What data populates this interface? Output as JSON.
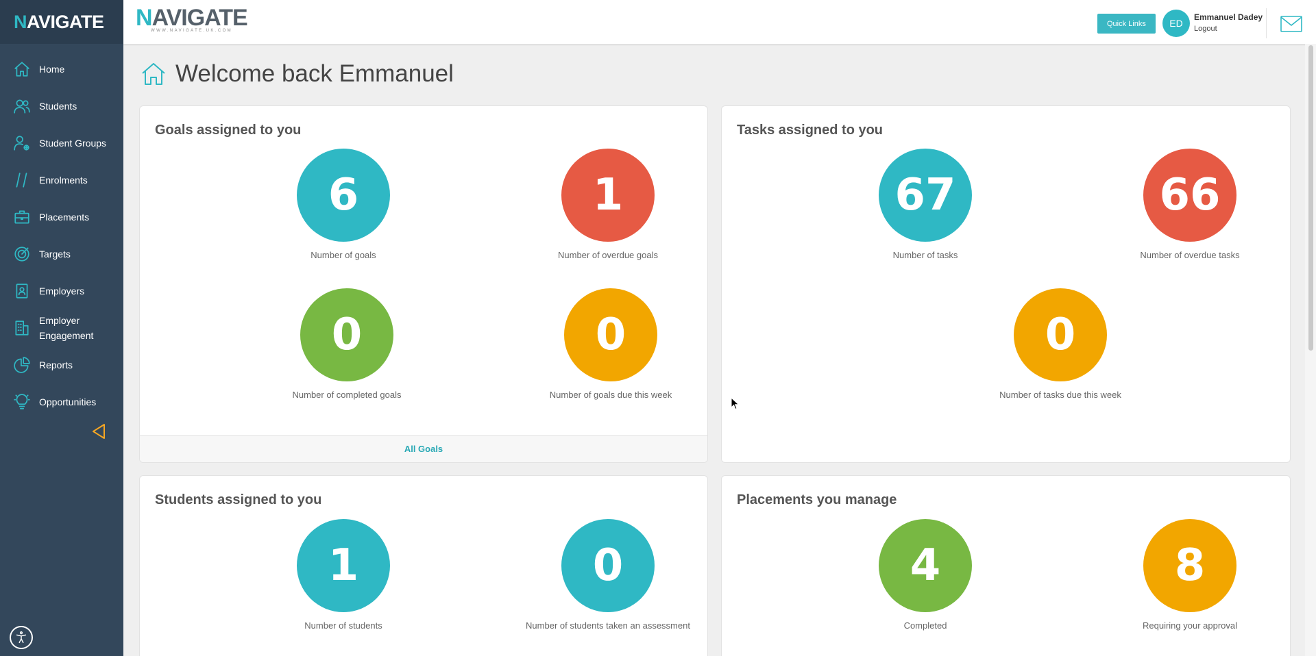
{
  "app": {
    "logo_text_n": "N",
    "logo_text_rest": "AVIGATE",
    "logo_tagline": "WWW.NAVIGATE.UK.COM"
  },
  "sidebar": {
    "items": [
      {
        "label": "Home",
        "icon": "home-icon"
      },
      {
        "label": "Students",
        "icon": "users-icon"
      },
      {
        "label": "Student Groups",
        "icon": "user-group-icon"
      },
      {
        "label": "Enrolments",
        "icon": "slashes-icon"
      },
      {
        "label": "Placements",
        "icon": "briefcase-icon"
      },
      {
        "label": "Targets",
        "icon": "target-icon"
      },
      {
        "label": "Employers",
        "icon": "id-badge-icon"
      },
      {
        "label": "Employer Engagement",
        "icon": "building-icon"
      },
      {
        "label": "Reports",
        "icon": "pie-chart-icon"
      },
      {
        "label": "Opportunities",
        "icon": "lightbulb-icon"
      }
    ]
  },
  "header": {
    "quick_links": "Quick Links",
    "user_initials": "ED",
    "user_name": "Emmanuel Dadey",
    "logout": "Logout"
  },
  "main": {
    "title": "Welcome back Emmanuel",
    "goals": {
      "title": "Goals assigned to you",
      "stats": [
        {
          "value": "6",
          "label": "Number of goals",
          "color": "#2fb8c4"
        },
        {
          "value": "1",
          "label": "Number of overdue goals",
          "color": "#e65a44"
        },
        {
          "value": "0",
          "label": "Number of completed goals",
          "color": "#78b843"
        },
        {
          "value": "0",
          "label": "Number of goals due this week",
          "color": "#f2a600"
        }
      ],
      "footer": "All Goals"
    },
    "tasks": {
      "title": "Tasks assigned to you",
      "stats": [
        {
          "value": "67",
          "label": "Number of tasks",
          "color": "#2fb8c4"
        },
        {
          "value": "66",
          "label": "Number of overdue tasks",
          "color": "#e65a44"
        },
        {
          "value": "0",
          "label": "Number of tasks due this week",
          "color": "#f2a600"
        }
      ]
    },
    "students": {
      "title": "Students assigned to you",
      "stats": [
        {
          "value": "1",
          "label": "Number of students",
          "color": "#2fb8c4"
        },
        {
          "value": "0",
          "label": "Number of students taken an assessment",
          "color": "#2fb8c4"
        }
      ]
    },
    "placements": {
      "title": "Placements you manage",
      "stats": [
        {
          "value": "4",
          "label": "Completed",
          "color": "#78b843"
        },
        {
          "value": "8",
          "label": "Requiring your approval",
          "color": "#f2a600"
        }
      ]
    }
  }
}
